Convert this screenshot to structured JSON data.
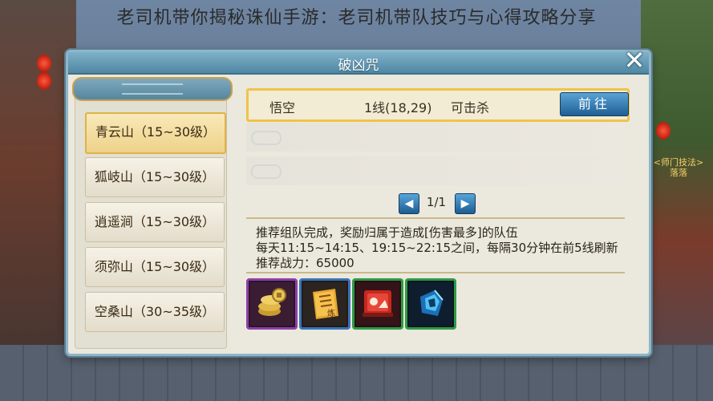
{
  "page_title": "老司机带你揭秘诛仙手游：老司机带队技巧与心得攻略分享",
  "window": {
    "title": "破凶咒"
  },
  "regions": [
    {
      "label": "青云山（15~30级）",
      "active": true
    },
    {
      "label": "狐岐山（15~30级）",
      "active": false
    },
    {
      "label": "逍遥涧（15~30级）",
      "active": false
    },
    {
      "label": "须弥山（15~30级）",
      "active": false
    },
    {
      "label": "空桑山（30~35级）",
      "active": false
    }
  ],
  "target": {
    "name": "悟空",
    "line": "1线(18,29)",
    "status": "可击杀",
    "go_label": "前往"
  },
  "pager": {
    "text": "1/1",
    "prev_icon": "arrow-left-icon",
    "next_icon": "arrow-right-icon"
  },
  "description": {
    "line1": "推荐组队完成，奖励归属于造成[伤害最多]的队伍",
    "line2": "每天11:15~14:15、19:15~22:15之间，每隔30分钟在前5线刷新",
    "line3": "推荐战力：65000"
  },
  "rewards": [
    {
      "icon": "coins-icon",
      "frame": "#8e3fa8"
    },
    {
      "icon": "scroll-icon",
      "frame": "#3a73b8"
    },
    {
      "icon": "red-scroll-icon",
      "frame": "#2f9a45"
    },
    {
      "icon": "blue-crystal-icon",
      "frame": "#2f9a45"
    }
  ],
  "npc_label": "<师门技法>\n落落"
}
